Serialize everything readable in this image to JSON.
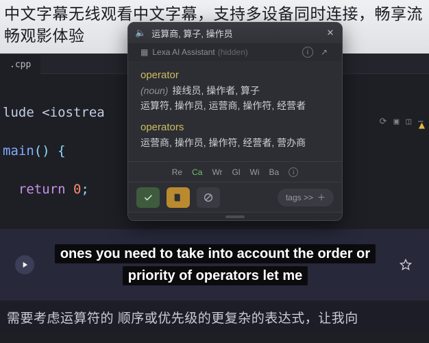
{
  "banner": {
    "text": "中文字幕无线观看中文字幕，支持多设备同时连接，畅享流畅观影体验"
  },
  "editor": {
    "tab_label": ".cpp",
    "line_include_kw": "lude ",
    "line_include_arg": "<iostrea",
    "line_main_kw": "main",
    "line_main_paren": "()",
    "line_main_brace": " {",
    "line_return_kw": "return ",
    "line_return_val": "0",
    "line_return_semi": ";"
  },
  "dict": {
    "header_title": "运算商, 算子, 操作员",
    "assistant_label": "Lexa AI Assistant",
    "assistant_hidden": "(hidden)",
    "entry1": {
      "word": "operator",
      "pos": "(noun)",
      "def_line1": "接线员, 操作者, 算子",
      "def_line2": "运算符, 操作员, 运营商, 操作符, 经营者"
    },
    "entry2": {
      "word": "operators",
      "def": "运营商, 操作员, 操作符, 经营者, 营办商"
    },
    "tabs": {
      "re": "Re",
      "ca": "Ca",
      "wr": "Wr",
      "gl": "Gl",
      "wi": "Wi",
      "ba": "Ba"
    },
    "tags_label": "tags >>"
  },
  "subtitles": {
    "en": "ones you need to take into account the order or priority of operators let me",
    "zh": "需要考虑运算符的 顺序或优先级的更复杂的表达式，让我向"
  }
}
